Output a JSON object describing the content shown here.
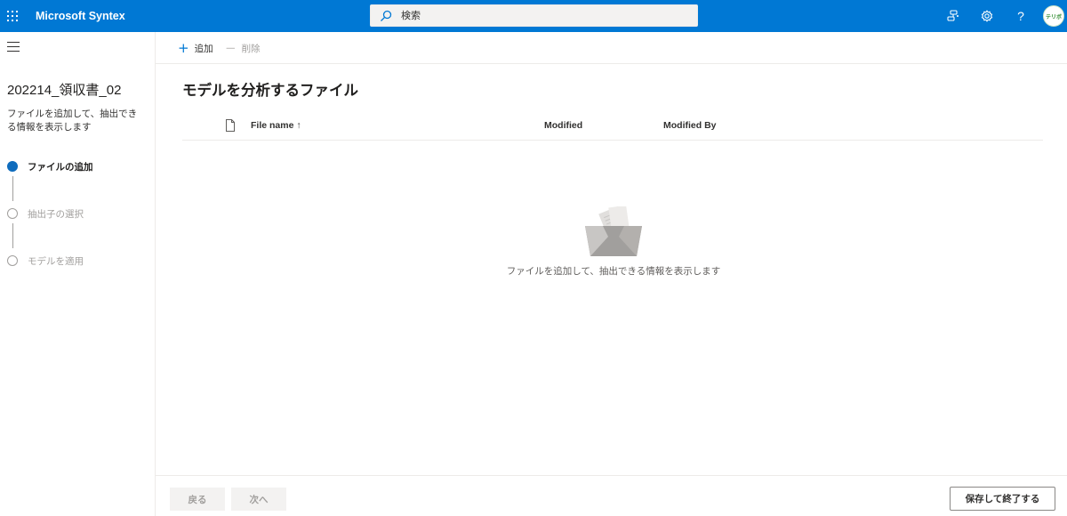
{
  "app": {
    "title": "Microsoft Syntex"
  },
  "search": {
    "placeholder": "検索"
  },
  "header_icons": [
    "apps-icon",
    "share-icon",
    "settings-icon",
    "help-icon"
  ],
  "help_label": "?",
  "avatar": {
    "text": "テリボ"
  },
  "sidebar": {
    "model_name": "202214_領収書_02",
    "description": "ファイルを追加して、抽出できる情報を表示します",
    "steps": [
      {
        "label": "ファイルの追加",
        "active": true
      },
      {
        "label": "抽出子の選択",
        "active": false
      },
      {
        "label": "モデルを適用",
        "active": false
      }
    ]
  },
  "commands": {
    "add": "追加",
    "delete": "削除"
  },
  "main": {
    "title": "モデルを分析するファイル",
    "columns": {
      "file_name": "File name ↑",
      "modified": "Modified",
      "modified_by": "Modified By"
    },
    "empty_message": "ファイルを追加して、抽出できる情報を表示します"
  },
  "footer": {
    "back": "戻る",
    "next": "次へ",
    "save_exit": "保存して終了する"
  },
  "colors": {
    "header_bg": "#0078d4",
    "active_step": "#0f6cbd"
  }
}
